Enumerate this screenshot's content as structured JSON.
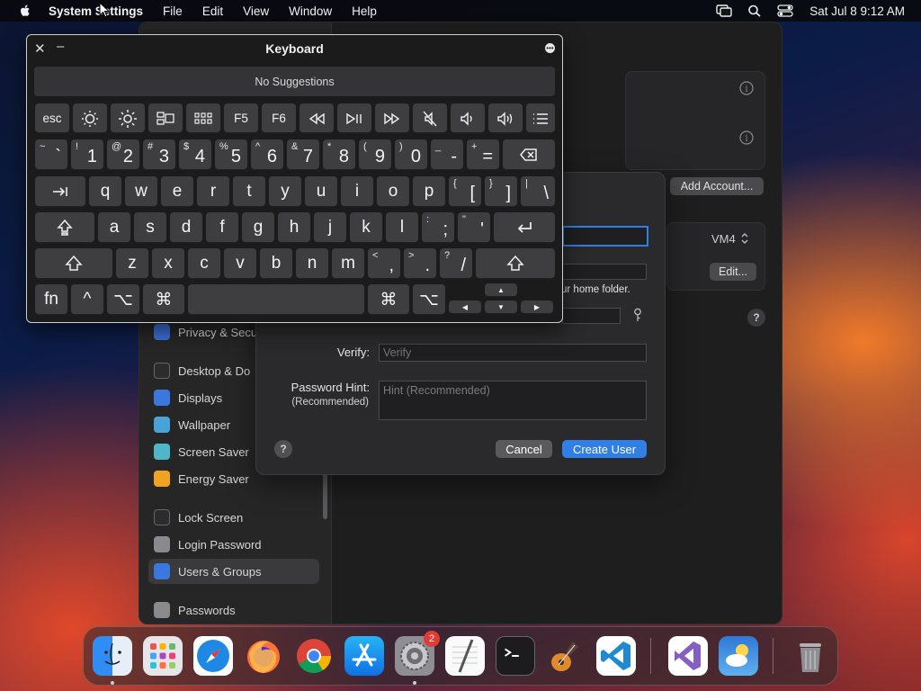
{
  "menubar": {
    "app": "System Settings",
    "menus": [
      "File",
      "Edit",
      "View",
      "Window",
      "Help"
    ],
    "clock": "Sat Jul 8  9:12 AM",
    "icons": [
      "apple-icon",
      "screen-mirroring-icon",
      "spotlight-search-icon",
      "control-center-icon"
    ]
  },
  "settings": {
    "sidebar": [
      {
        "label": "Privacy & Secu",
        "icon": "hand-icon",
        "color": "#3a6fd8"
      },
      {
        "label": "Desktop & Do",
        "icon": "dock-icon",
        "color": "#2c2c2e"
      },
      {
        "label": "Displays",
        "icon": "sun-icon",
        "color": "#3a78e0"
      },
      {
        "label": "Wallpaper",
        "icon": "flower-icon",
        "color": "#4aa3d8"
      },
      {
        "label": "Screen Saver",
        "icon": "screensaver-icon",
        "color": "#4fb6c9"
      },
      {
        "label": "Energy Saver",
        "icon": "battery-icon",
        "color": "#f0a321"
      },
      {
        "label": "Lock Screen",
        "icon": "lock-icon",
        "color": "#2c2c2e"
      },
      {
        "label": "Login Password",
        "icon": "lock-icon",
        "color": "#8a8a8e"
      },
      {
        "label": "Users & Groups",
        "icon": "users-icon",
        "color": "#3a78e0"
      },
      {
        "label": "Passwords",
        "icon": "key-icon",
        "color": "#8a8a8e"
      }
    ],
    "add_account": "Add Account...",
    "vm4": "VM4",
    "edit": "Edit...",
    "help": "?"
  },
  "sheet": {
    "partial_note": "ur home folder.",
    "verify_label": "Verify:",
    "verify_placeholder": "Verify",
    "hint_label": "Password Hint:",
    "hint_sub": "(Recommended)",
    "hint_placeholder": "Hint (Recommended)",
    "help": "?",
    "cancel": "Cancel",
    "create": "Create User"
  },
  "keyboard": {
    "title": "Keyboard",
    "suggestions": "No Suggestions",
    "fn_row": [
      "esc",
      "brightness-down-icon",
      "brightness-up-icon",
      "mission-control-icon",
      "launchpad-icon",
      "F5",
      "F6",
      "rewind-icon",
      "play-pause-icon",
      "fast-forward-icon",
      "mute-icon",
      "volume-down-icon",
      "volume-up-icon",
      "list-icon"
    ],
    "num_row": [
      {
        "s": "~",
        "m": "`"
      },
      {
        "s": "!",
        "m": "1"
      },
      {
        "s": "@",
        "m": "2"
      },
      {
        "s": "#",
        "m": "3"
      },
      {
        "s": "$",
        "m": "4"
      },
      {
        "s": "%",
        "m": "5"
      },
      {
        "s": "^",
        "m": "6"
      },
      {
        "s": "&",
        "m": "7"
      },
      {
        "s": "*",
        "m": "8"
      },
      {
        "s": "(",
        "m": "9"
      },
      {
        "s": ")",
        "m": "0"
      },
      {
        "s": "_",
        "m": "-"
      },
      {
        "s": "+",
        "m": "="
      }
    ],
    "row_q": [
      "q",
      "w",
      "e",
      "r",
      "t",
      "y",
      "u",
      "i",
      "o",
      "p"
    ],
    "row_q_sym": [
      {
        "s": "{",
        "m": "["
      },
      {
        "s": "}",
        "m": "]"
      },
      {
        "s": "|",
        "m": "\\"
      }
    ],
    "row_a": [
      "a",
      "s",
      "d",
      "f",
      "g",
      "h",
      "j",
      "k",
      "l"
    ],
    "row_a_sym": [
      {
        "s": ":",
        "m": ";"
      },
      {
        "s": "\"",
        "m": "'"
      }
    ],
    "row_z": [
      "z",
      "x",
      "c",
      "v",
      "b",
      "n",
      "m"
    ],
    "row_z_sym": [
      {
        "s": "<",
        "m": ","
      },
      {
        "s": ">",
        "m": "."
      },
      {
        "s": "?",
        "m": "/"
      }
    ],
    "bottom": {
      "fn": "fn",
      "ctrl": "^",
      "opt": "⌥",
      "cmd": "⌘"
    }
  },
  "dock": [
    "finder-icon",
    "launchpad-icon",
    "safari-icon",
    "firefox-icon",
    "chrome-icon",
    "app-store-icon",
    "system-settings-icon",
    "textedit-icon",
    "terminal-icon",
    "garageband-icon",
    "vscode-icon",
    "visual-studio-icon",
    "weather-icon",
    "trash-icon"
  ],
  "dock_badge": "2"
}
